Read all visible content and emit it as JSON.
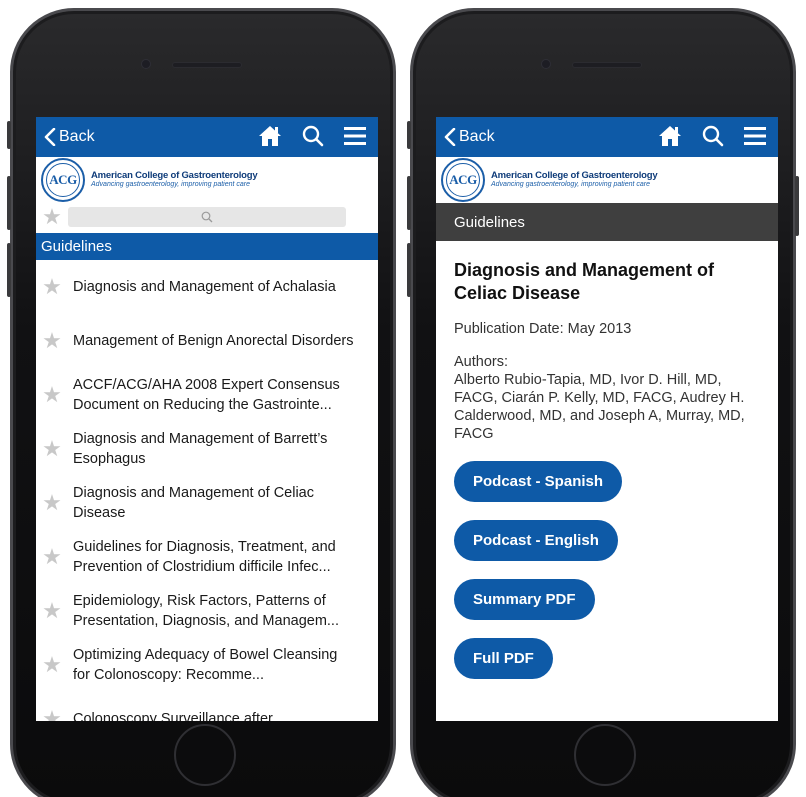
{
  "left_screen": {
    "nav": {
      "back_label": "Back"
    },
    "logo": {
      "seal_text": "ACG",
      "title": "American College of Gastroenterology",
      "subtitle": "Advancing gastroenterology, improving patient care"
    },
    "section_title": "Guidelines",
    "items": [
      {
        "label": "Diagnosis and Management of Achalasia"
      },
      {
        "label": "Management of Benign Anorectal Disorders"
      },
      {
        "label": "ACCF/ACG/AHA 2008 Expert Consensus Document on Reducing the Gastrointe..."
      },
      {
        "label": "Diagnosis and Management of Barrett’s Esophagus"
      },
      {
        "label": "Diagnosis and Management of Celiac Disease"
      },
      {
        "label": "Guidelines for Diagnosis, Treatment, and Prevention of Clostridium difficile Infec..."
      },
      {
        "label": "Epidemiology, Risk Factors, Patterns of Presentation, Diagnosis, and Managem..."
      },
      {
        "label": "Optimizing Adequacy of Bowel Cleansing for Colonoscopy: Recomme..."
      },
      {
        "label": "Colonoscopy Surveillance after"
      }
    ]
  },
  "right_screen": {
    "nav": {
      "back_label": "Back"
    },
    "logo": {
      "seal_text": "ACG",
      "title": "American College of Gastroenterology",
      "subtitle": "Advancing gastroenterology, improving patient care"
    },
    "section_title": "Guidelines",
    "detail": {
      "title": "Diagnosis and Management of Celiac Disease",
      "publication": "Publication Date: May 2013",
      "authors_label": "Authors:",
      "authors": "Alberto Rubio-Tapia, MD, Ivor D. Hill, MD, FACG, Ciarán P. Kelly, MD, FACG, Audrey H. Calderwood, MD, and Joseph A, Murray, MD, FACG"
    },
    "buttons": {
      "podcast_spanish": "Podcast - Spanish",
      "podcast_english": "Podcast - English",
      "summary_pdf": "Summary PDF",
      "full_pdf": "Full PDF"
    }
  },
  "colors": {
    "brand_blue": "#0e5aa7",
    "section_dark": "#3f3f3f",
    "star_gray": "#c8c8c8"
  },
  "icons": [
    "back-chevron-icon",
    "home-icon",
    "search-icon",
    "menu-icon",
    "star-icon"
  ]
}
